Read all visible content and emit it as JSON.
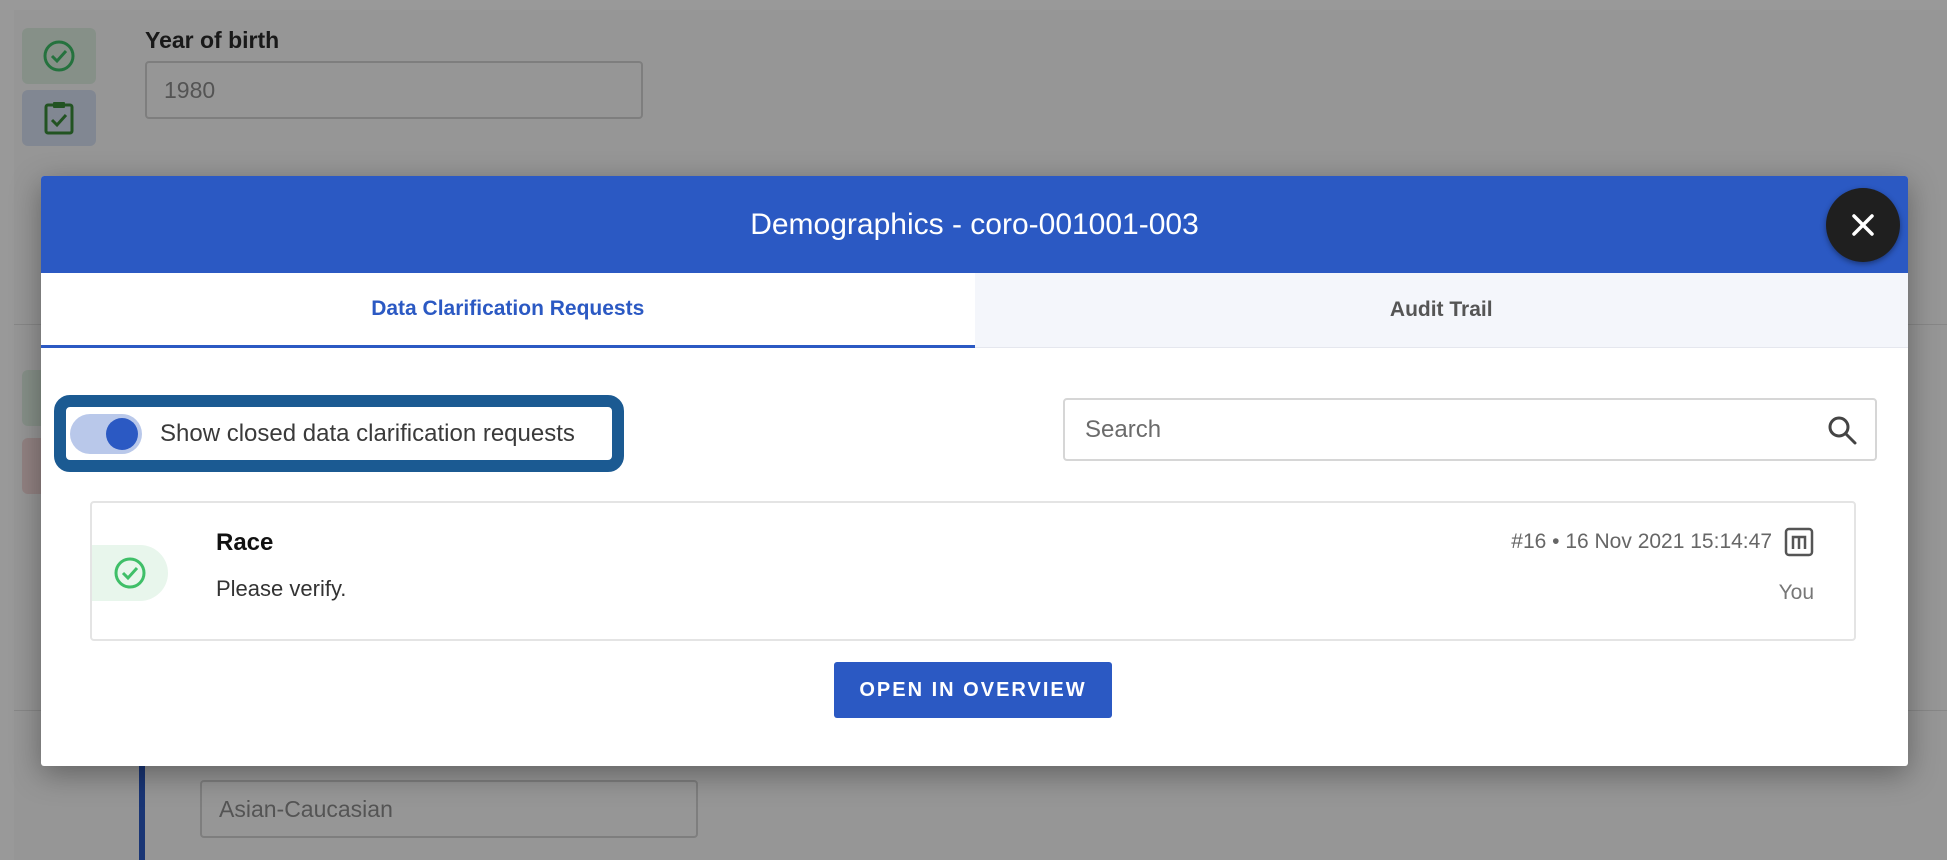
{
  "background_form": {
    "year_of_birth": {
      "label": "Year of birth",
      "value": "1980"
    },
    "ethnicity": {
      "value": "Asian-Caucasian"
    }
  },
  "modal": {
    "title": "Demographics - coro-001001-003",
    "tabs": [
      {
        "label": "Data Clarification Requests",
        "active": true
      },
      {
        "label": "Audit Trail",
        "active": false
      }
    ],
    "toggle": {
      "label": "Show closed data clarification requests",
      "checked": true
    },
    "search": {
      "placeholder": "Search"
    },
    "requests": [
      {
        "title": "Race",
        "message": "Please verify.",
        "meta": "#16 • 16 Nov 2021 15:14:47",
        "author": "You",
        "status": "closed"
      }
    ],
    "open_button_label": "OPEN IN OVERVIEW"
  },
  "colors": {
    "primary": "#2b59c3",
    "highlight_border": "#1b5a92",
    "success": "#3fbf68",
    "close_button": "#1f1f1f"
  },
  "icons": {
    "status": "check-circle-icon",
    "checklist": "clipboard-check-icon",
    "search": "search-icon",
    "meta": "m-square-icon",
    "close": "close-icon"
  }
}
